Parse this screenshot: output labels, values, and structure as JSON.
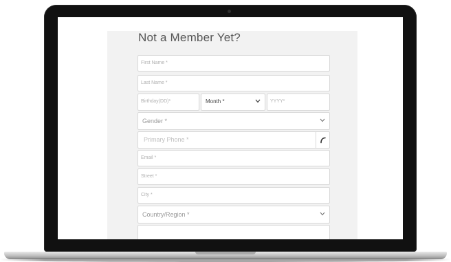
{
  "form": {
    "title": "Not a Member Yet?",
    "first_name_placeholder": "First Name *",
    "last_name_placeholder": "Last Name *",
    "birthday_day_placeholder": "Birthday(DD)*",
    "birthday_month_value": "Month *",
    "birthday_year_placeholder": "YYYY*",
    "gender_value": "Gender *",
    "primary_phone_placeholder": "Primary Phone *",
    "email_placeholder": "Email *",
    "street_placeholder": "Street *",
    "city_placeholder": "City *",
    "country_region_value": "Country/Region *"
  },
  "icons": {
    "dropdown": "chevron-down-icon",
    "phone": "phone-icon"
  },
  "colors": {
    "panel_bg": "#f2f2f2",
    "field_border": "#d8d8d8",
    "placeholder_text": "#b0b0b0",
    "title_text": "#555555"
  }
}
